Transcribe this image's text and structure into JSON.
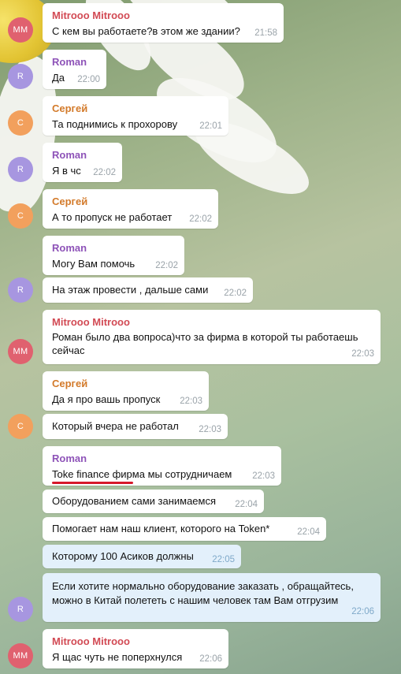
{
  "colors": {
    "mitrooo_name": "#d24a54",
    "roman_name": "#8e53b8",
    "sergey_name": "#d37a2a",
    "avatar_mm": "#e0616f",
    "avatar_r": "#a796e0",
    "avatar_c": "#f2a05d",
    "outgoing_bubble": "#e3f0fb"
  },
  "avatars": {
    "mm": "MM",
    "r": "R",
    "c": "C"
  },
  "messages": [
    {
      "sender": "Mitrooo Mitrooo",
      "text": "С кем вы работаете?в этом же здании?",
      "time": "21:58"
    },
    {
      "sender": "Roman",
      "text": "Да",
      "time": "22:00"
    },
    {
      "sender": "Сергей",
      "text": "Та поднимись к прохорову",
      "time": "22:01"
    },
    {
      "sender": "Roman",
      "text": "Я в чс",
      "time": "22:02"
    },
    {
      "sender": "Сергей",
      "text": "А то пропуск не работает",
      "time": "22:02"
    },
    {
      "sender": "Roman",
      "text": "Могу Вам помочь",
      "time": "22:02"
    },
    {
      "text": "На этаж провести , дальше сами",
      "time": "22:02"
    },
    {
      "sender": "Mitrooo Mitrooo",
      "text_line1": "Роман было два вопроса)что за фирма в которой ты работаешь",
      "text_line2": "сейчас",
      "time": "22:03"
    },
    {
      "sender": "Сергей",
      "text": "Да я про вашь пропуск",
      "time": "22:03"
    },
    {
      "text": "Который вчера не работал",
      "time": "22:03"
    },
    {
      "sender": "Roman",
      "text": "Toke finance фирма мы сотрудничаем",
      "time": "22:03"
    },
    {
      "text": "Оборудованием сами занимаемся",
      "time": "22:04"
    },
    {
      "text": "Помогает нам наш клиент, которого на Token*",
      "time": "22:04"
    },
    {
      "text": "Которому 100 Асиков должны",
      "time": "22:05"
    },
    {
      "text_line1": "Если хотите нормально оборудование заказать , обращайтесь,",
      "text_line2": "можно в Китай полететь с нашим человек там Вам отгрузим",
      "time": "22:06"
    },
    {
      "sender": "Mitrooo Mitrooo",
      "text": "Я щас чуть не поперхнулся",
      "time": "22:06"
    }
  ]
}
